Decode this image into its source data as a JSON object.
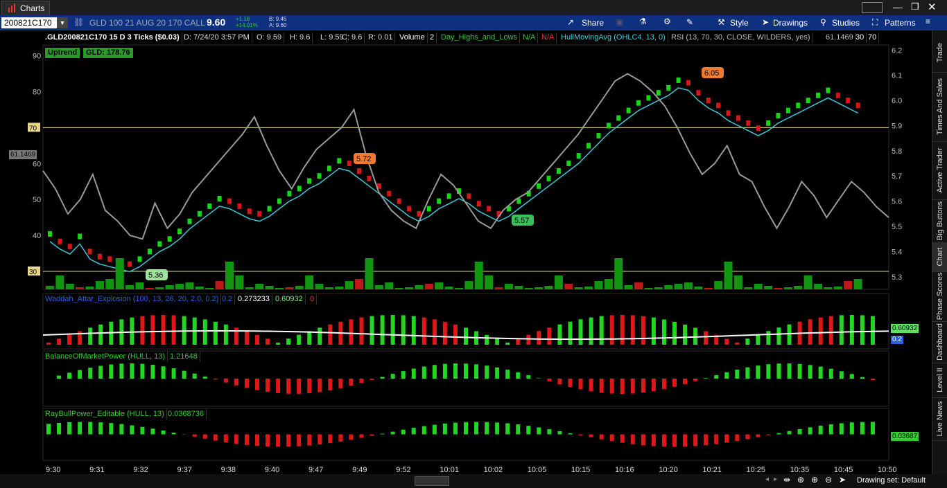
{
  "window": {
    "tab_title": "Charts"
  },
  "toolbar": {
    "symbol": "200821C170",
    "description": "GLD 100 21 AUG 20 170 CALL",
    "last": "9.60",
    "net_change": "+1.18",
    "pct_change": "+14.01%",
    "bid": "B: 9.45",
    "ask": "A: 9.60",
    "share_label": "Share",
    "style_label": "Style",
    "drawings_label": "Drawings",
    "studies_label": "Studies",
    "patterns_label": "Patterns"
  },
  "header": {
    "title": ".GLD200821C170 15 D 3 Ticks ($0.03)",
    "date": "D: 7/24/20 3:57 PM",
    "open": "O: 9.59",
    "high": "H: 9.6",
    "low": "L: 9.59",
    "close": "C: 9.6",
    "range": "R: 0.01",
    "volume_label": "Volume",
    "volume_value": "2",
    "day_hl": "Day_Highs_and_Lows",
    "na1": "N/A",
    "na2": "N/A",
    "hull": "HullMovingAvg (OHLC4, 13, 0)",
    "rsi": "RSI (13, 70, 30, CLOSE, WILDERS, yes)",
    "rsi_value": "61.1469",
    "ob": "30",
    "os": "70"
  },
  "badges": {
    "trend": "Uptrend",
    "underlying": "GLD:  178.76"
  },
  "panels": {
    "waddah": {
      "title": "Waddah_Attar_Explosion (100, 13, 26, 20, 2.0, 0.2)",
      "v1": "0.2",
      "v2": "0.273233",
      "v3": "0.60932",
      "v4": "0",
      "right_val": "0.60932",
      "right_val2": "0.2"
    },
    "bop": {
      "title": "BalanceOfMarketPower (HULL, 13)",
      "value": "1.21648"
    },
    "ray": {
      "title": "RayBullPower_Editable (HULL, 13)",
      "value": "0.0368736",
      "right_val": "0.03687"
    }
  },
  "rsi_tag": "61.1469",
  "status": {
    "drawing_set": "Drawing set: Default"
  },
  "right_tabs": [
    "Trade",
    "Times And Sales",
    "Active Trader",
    "Big Buttons",
    "Chart",
    "Phase Scores",
    "Dashboard",
    "Level II",
    "Live News"
  ],
  "chart_data": {
    "type": "line",
    "price_axis": {
      "ticks": [
        5.3,
        5.4,
        5.5,
        5.6,
        5.7,
        5.8,
        5.9,
        6.0,
        6.1,
        6.2
      ],
      "range": [
        5.25,
        6.22
      ]
    },
    "rsi_axis": {
      "ticks": [
        30,
        40,
        50,
        60,
        70,
        80,
        90
      ],
      "range": [
        25,
        93
      ],
      "levels": [
        30,
        70
      ]
    },
    "time_labels": [
      "9:30",
      "9:31",
      "9:32",
      "9:37",
      "9:38",
      "9:40",
      "9:47",
      "9:49",
      "9:52",
      "10:01",
      "10:02",
      "10:05",
      "10:15",
      "10:16",
      "10:20",
      "10:21",
      "10:25",
      "10:35",
      "10:45",
      "10:50"
    ],
    "price_labels": [
      "5.36",
      "5.72",
      "5.57",
      "6.05"
    ],
    "closes": [
      5.47,
      5.44,
      5.42,
      5.46,
      5.4,
      5.38,
      5.37,
      5.36,
      5.35,
      5.37,
      5.4,
      5.43,
      5.45,
      5.48,
      5.52,
      5.55,
      5.58,
      5.61,
      5.6,
      5.58,
      5.56,
      5.55,
      5.57,
      5.6,
      5.63,
      5.65,
      5.68,
      5.7,
      5.73,
      5.76,
      5.75,
      5.72,
      5.69,
      5.66,
      5.63,
      5.6,
      5.57,
      5.55,
      5.57,
      5.6,
      5.62,
      5.64,
      5.62,
      5.59,
      5.57,
      5.55,
      5.57,
      5.6,
      5.63,
      5.66,
      5.69,
      5.72,
      5.75,
      5.78,
      5.82,
      5.86,
      5.9,
      5.93,
      5.96,
      5.99,
      6.01,
      6.03,
      6.05,
      6.08,
      6.07,
      6.03,
      6.0,
      5.98,
      5.95,
      5.93,
      5.91,
      5.89,
      5.91,
      5.94,
      5.96,
      5.98,
      6.0,
      6.02,
      6.04,
      6.02,
      6.0,
      5.98
    ],
    "rsi": [
      58,
      53,
      46,
      50,
      57,
      47,
      44,
      40,
      39,
      49,
      42,
      46,
      52,
      56,
      60,
      64,
      68,
      73,
      65,
      58,
      53,
      59,
      64,
      67,
      70,
      75,
      62,
      52,
      47,
      44,
      42,
      50,
      57,
      54,
      49,
      44,
      42,
      47,
      50,
      52,
      56,
      60,
      64,
      68,
      73,
      78,
      83,
      85,
      83,
      80,
      76,
      70,
      63,
      57,
      60,
      65,
      57,
      55,
      48,
      42,
      48,
      55,
      51,
      45,
      50,
      55,
      52,
      48,
      45
    ]
  }
}
